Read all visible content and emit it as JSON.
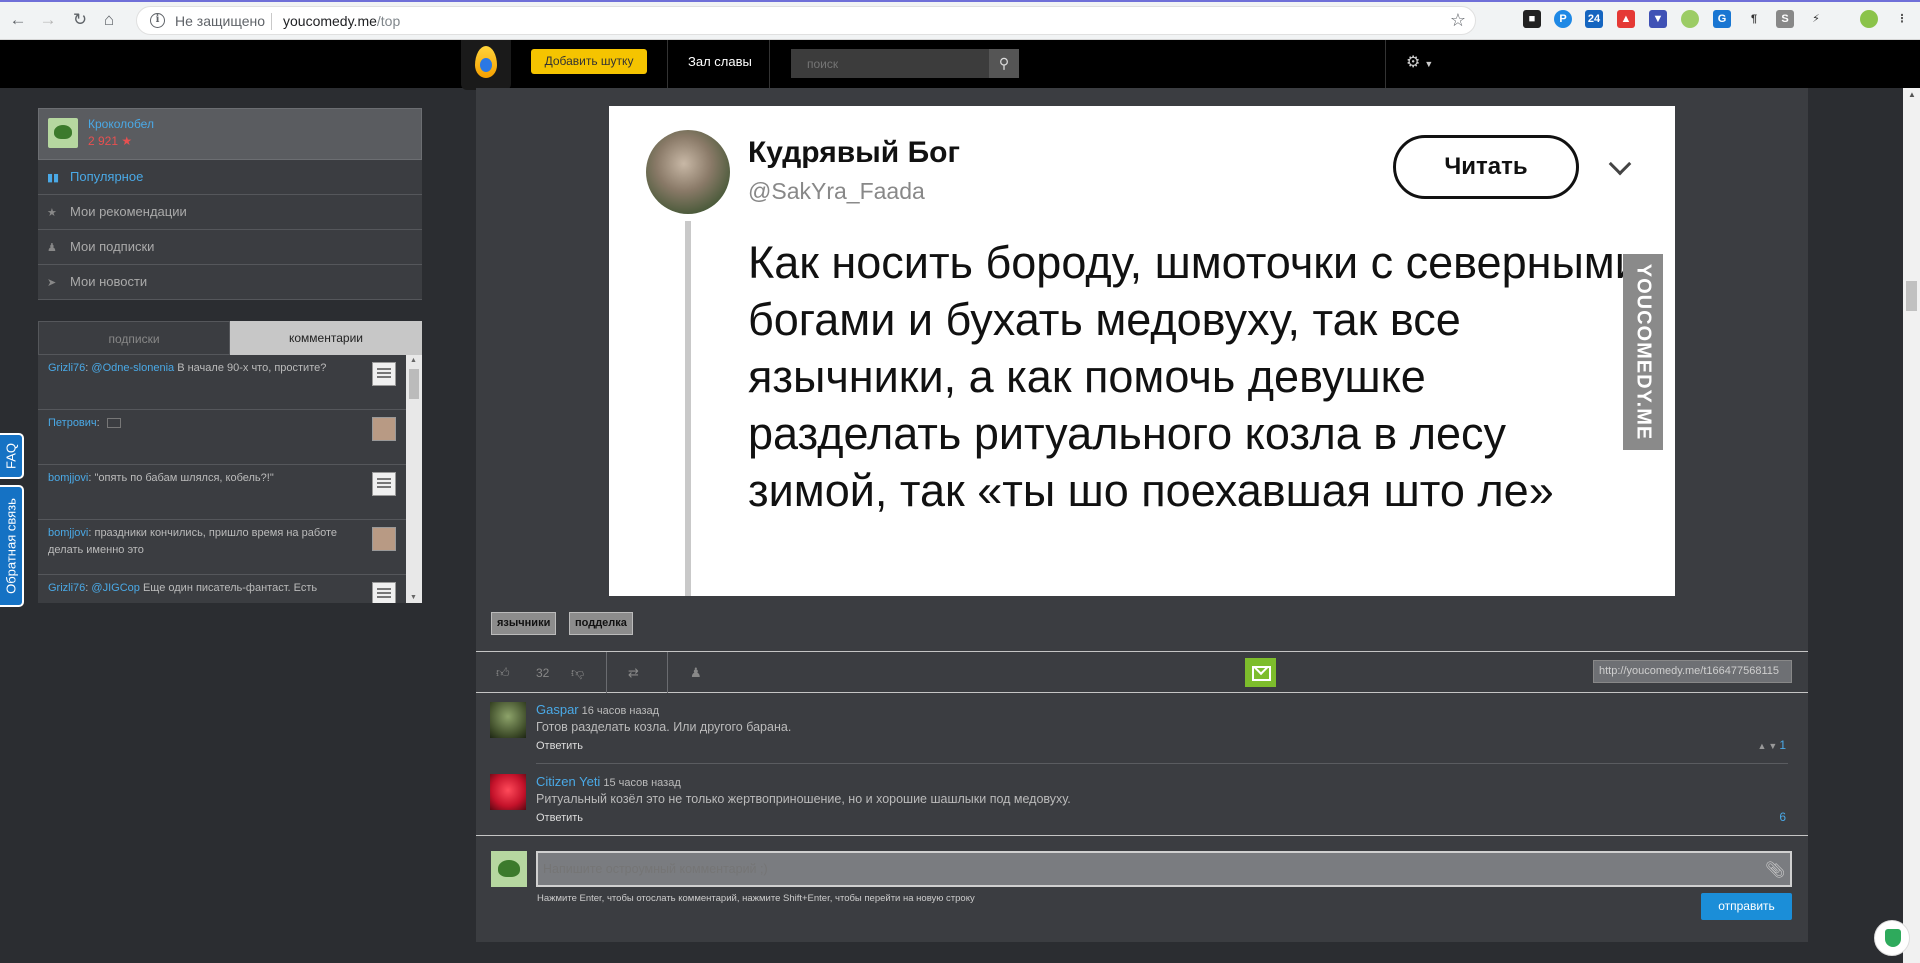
{
  "browser": {
    "security_label": "Не защищено",
    "url_host": "youcomedy.me",
    "url_path": "/top"
  },
  "header": {
    "add_joke_label": "Добавить шутку",
    "hall_of_fame_label": "Зал славы",
    "search_placeholder": "поиск"
  },
  "sidebar": {
    "user": {
      "name": "Кроколобел",
      "rating": "2 921 ★"
    },
    "menu": [
      {
        "label": "Популярное",
        "icon": "bar-chart-icon",
        "active": true
      },
      {
        "label": "Мои рекомендации",
        "icon": "star-icon"
      },
      {
        "label": "Мои подписки",
        "icon": "users-icon"
      },
      {
        "label": "Мои новости",
        "icon": "megaphone-icon"
      }
    ],
    "tabs": [
      "подписки",
      "комментарии"
    ],
    "comments": [
      {
        "user": "Grizli76",
        "mention": "@Odne-slonenia",
        "text": "В начале 90-х что, простите?"
      },
      {
        "user": "Петрович",
        "mention": "",
        "text": ""
      },
      {
        "user": "bomjjovi",
        "mention": "",
        "text": "\"опять по бабам шлялся, кобель?!\""
      },
      {
        "user": "bomjjovi",
        "mention": "",
        "text": "праздники кончились, пришло время на работе делать именно это"
      },
      {
        "user": "Grizli76",
        "mention": "@JIGCop",
        "text": "Еще один писатель-фантаст. Есть"
      }
    ]
  },
  "side_buttons": {
    "faq": "FAQ",
    "feedback": "Обратная связь"
  },
  "post": {
    "image": {
      "author_name": "Кудрявый Бог",
      "author_handle": "@SakYra_Faada",
      "follow_label": "Читать",
      "text": "Как носить бороду, шмоточки с северными богами и бухать медовуху, так все язычники, а как помочь девушке разделать ритуального козла в лесу зимой, так «ты шо поехавшая што ле»",
      "watermark": "YOUCOMEDY.ME"
    },
    "tags": [
      "язычники",
      "подделка"
    ],
    "rating": "32",
    "permalink": "http://youcomedy.me/t166477568115"
  },
  "comments": [
    {
      "user": "Gaspar",
      "time": "16 часов назад",
      "text": "Готов разделать козла. Или другого барана.",
      "reply_label": "Ответить",
      "votes": "1"
    },
    {
      "user": "Citizen Yeti",
      "time": "15 часов назад",
      "text": "Ритуальный козёл это не только жертвоприношение, но и хорошие шашлыки под медовуху.",
      "reply_label": "Ответить",
      "votes": "6"
    }
  ],
  "comment_form": {
    "placeholder": "Напишите остроумный комментарий ;)",
    "hint": "Нажмите Enter, чтобы отослать комментарий, нажмите Shift+Enter, чтобы перейти на новую строку",
    "send_label": "отправить"
  }
}
